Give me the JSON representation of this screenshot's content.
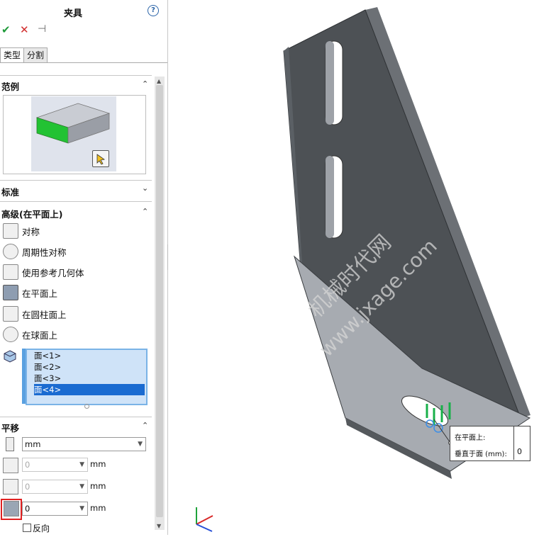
{
  "panel": {
    "title": "夹具",
    "help_icon": "?",
    "tabs": [
      "类型",
      "分割"
    ],
    "sections": {
      "examples": "范例",
      "standard": "标准",
      "advanced": "高级(在平面上)",
      "translate": "平移"
    },
    "options": [
      {
        "label": "对称",
        "icon": "symmetry-icon"
      },
      {
        "label": "周期性对称",
        "icon": "cyclic-symmetry-icon"
      },
      {
        "label": "使用参考几何体",
        "icon": "reference-geometry-icon"
      },
      {
        "label": "在平面上",
        "icon": "on-flat-face-icon",
        "selected": true
      },
      {
        "label": "在圆柱面上",
        "icon": "on-cylindrical-face-icon"
      },
      {
        "label": "在球面上",
        "icon": "on-spherical-face-icon"
      }
    ],
    "faces": [
      "面<1>",
      "面<2>",
      "面<3>",
      "面<4>"
    ],
    "selected_face_index": 3,
    "units": "mm",
    "translations": [
      {
        "value": "0",
        "unit": "mm",
        "enabled": false
      },
      {
        "value": "0",
        "unit": "mm",
        "enabled": false
      },
      {
        "value": "0",
        "unit": "mm",
        "enabled": true
      }
    ],
    "reverse_label": "反向"
  },
  "viewport": {
    "watermark_line1": "机械时代网",
    "watermark_line2": "www.jxage.com",
    "tooltip_title": "在平面上:",
    "tooltip_label": "垂直于面 (mm):",
    "tooltip_value": "0"
  },
  "colors": {
    "accent": "#1a6bd1",
    "ok": "#1f9a3a",
    "cancel": "#d12b2b",
    "highlight_box": "#e02020",
    "part": "#4a4e52"
  }
}
